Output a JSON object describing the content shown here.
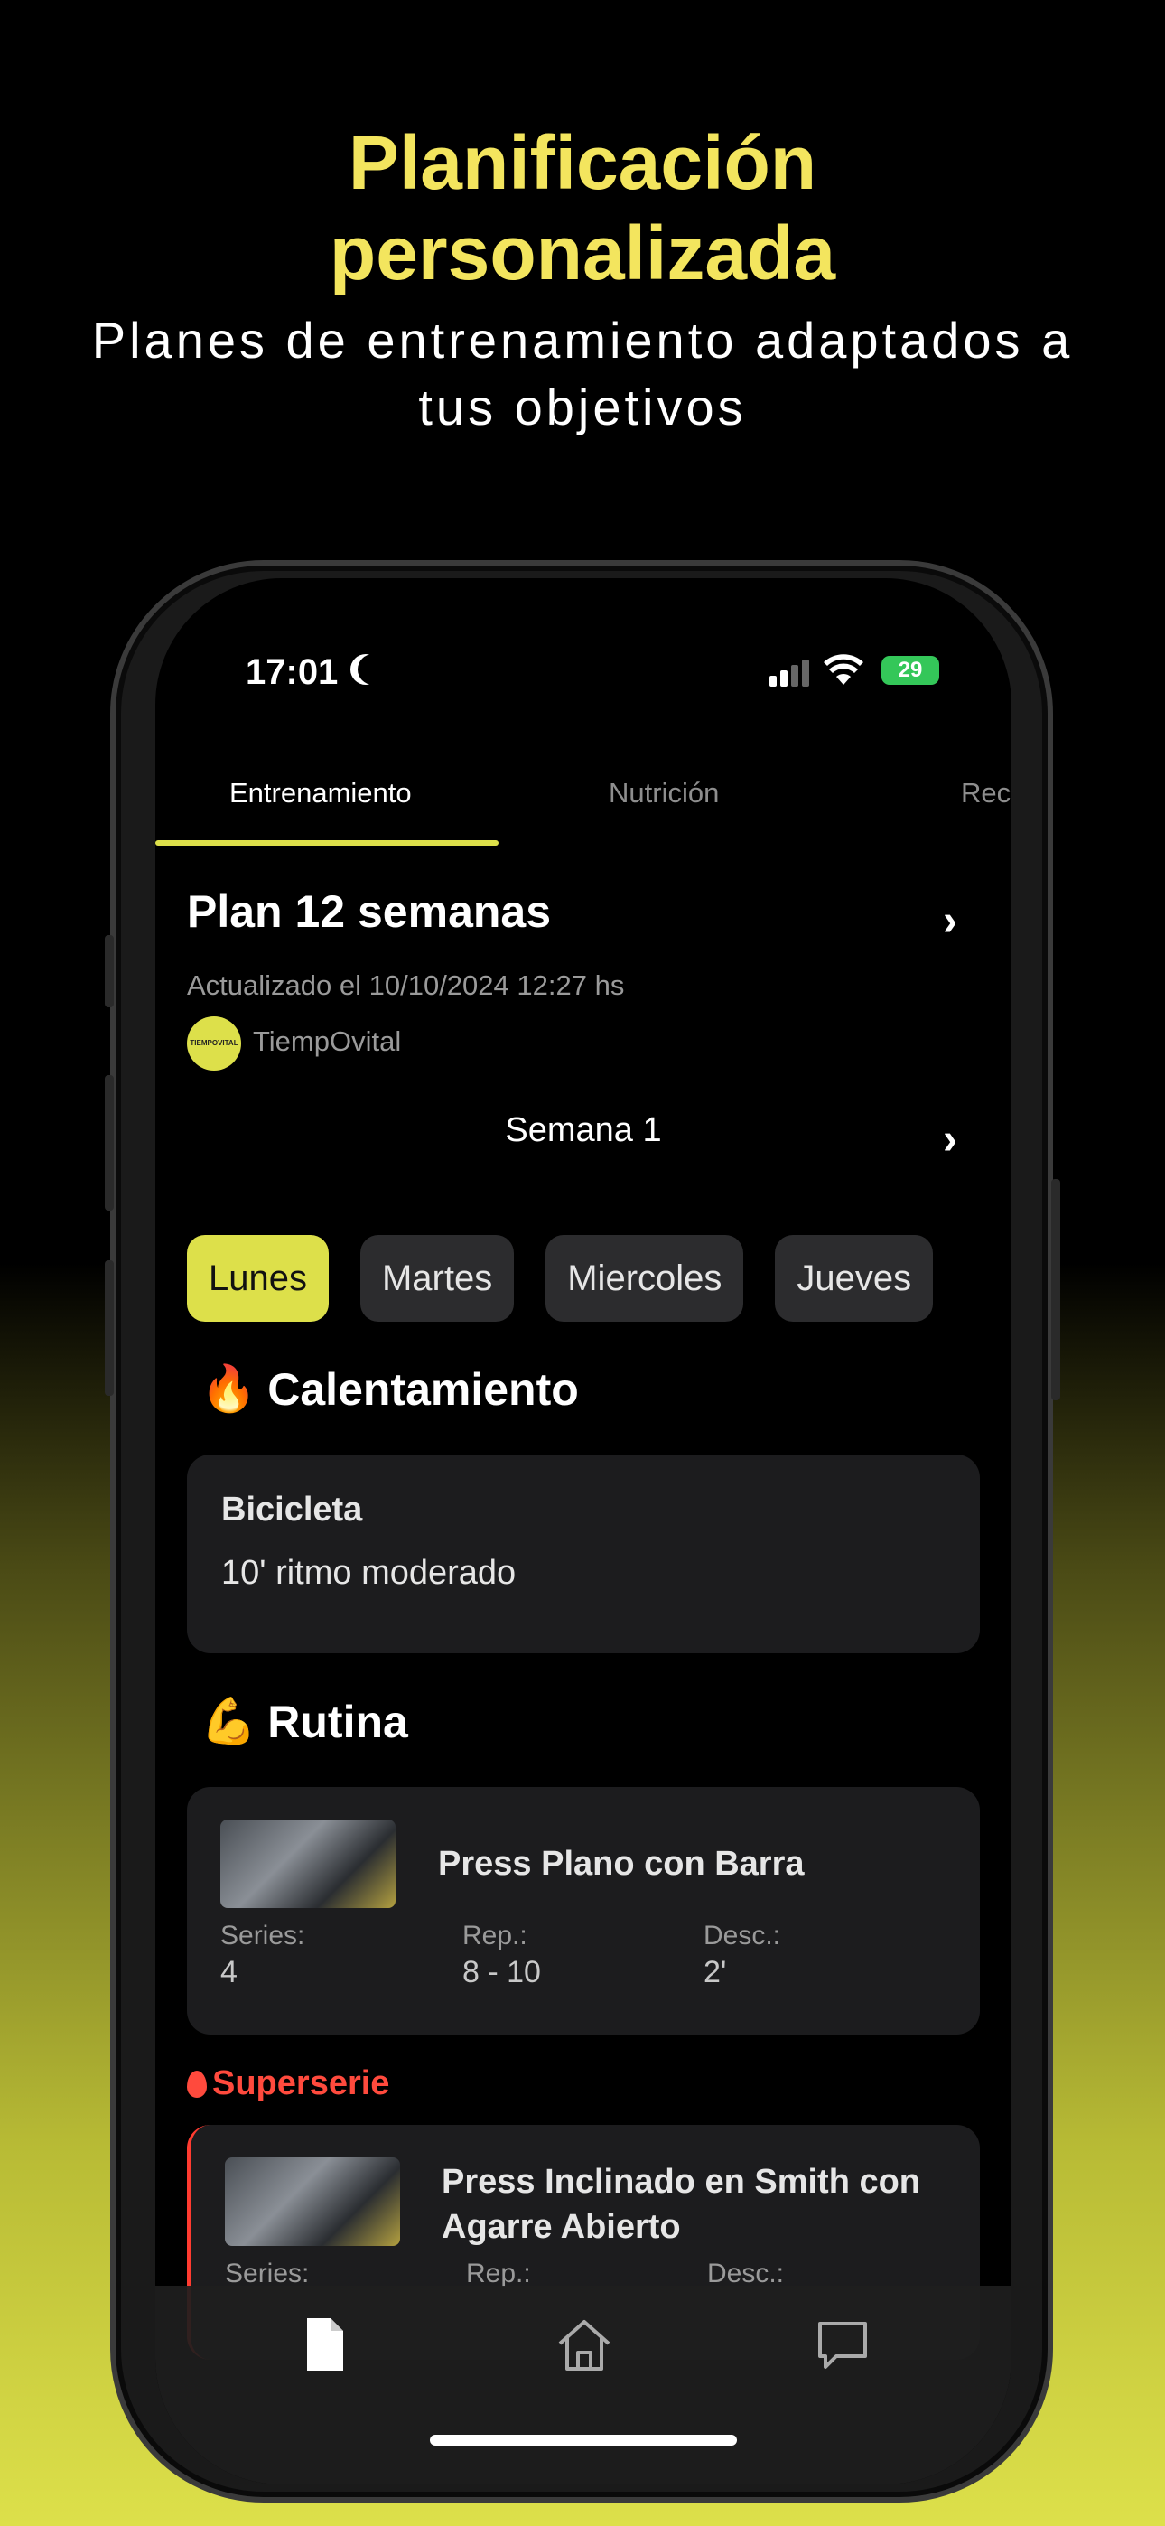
{
  "promo": {
    "headline_line1": "Planificación",
    "headline_line2": "personalizada",
    "subhead_line1": "Planes de entrenamiento adaptados a",
    "subhead_line2": "tus objetivos"
  },
  "status_bar": {
    "time": "17:01",
    "battery": "29"
  },
  "tabs": [
    {
      "label": "Entrenamiento",
      "active": true
    },
    {
      "label": "Nutrición",
      "active": false
    },
    {
      "label": "Rec",
      "active": false
    }
  ],
  "plan": {
    "title": "Plan 12 semanas",
    "updated": "Actualizado el 10/10/2024 12:27 hs",
    "coach_name": "TiempOvital",
    "coach_logo_text": "TIEMPOVITAL",
    "week": "Semana 1"
  },
  "days": [
    {
      "label": "Lunes",
      "active": true
    },
    {
      "label": "Martes",
      "active": false
    },
    {
      "label": "Miercoles",
      "active": false
    },
    {
      "label": "Jueves",
      "active": false
    }
  ],
  "warmup": {
    "section_emoji": "🔥",
    "section_title": "Calentamiento",
    "name": "Bicicleta",
    "description": "10' ritmo moderado"
  },
  "routine": {
    "section_emoji": "💪",
    "section_title": "Rutina",
    "exercise1": {
      "name": "Press Plano con Barra",
      "series_label": "Series:",
      "series": "4",
      "reps_label": "Rep.:",
      "reps": "8 - 10",
      "rest_label": "Desc.:",
      "rest": "2'"
    },
    "superserie_label": "Superserie",
    "exercise2": {
      "name_line1": "Press Inclinado en Smith con",
      "name_line2": "Agarre Abierto",
      "series_label": "Series:",
      "reps_label": "Rep.:",
      "rest_label": "Desc.:"
    }
  },
  "bottom_nav": [
    "document-icon",
    "home-icon",
    "chat-icon"
  ],
  "colors": {
    "accent": "#dde04a",
    "headline": "#f3e55e",
    "superset": "#ff4a3d",
    "card": "#1c1c1e"
  }
}
